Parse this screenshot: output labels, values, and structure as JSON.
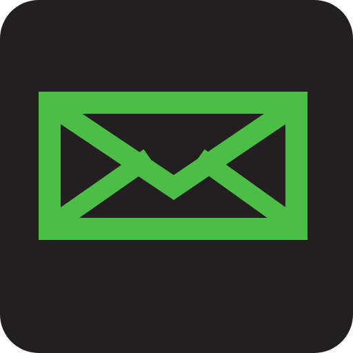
{
  "icon": {
    "name": "mail-envelope-icon",
    "background_color": "#231f20",
    "glyph_color": "#4cbe48"
  }
}
